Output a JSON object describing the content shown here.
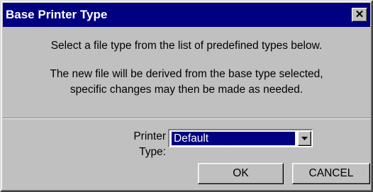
{
  "window": {
    "title": "Base Printer Type",
    "close_glyph": "✕"
  },
  "message": {
    "line1": "Select a file type from the list of predefined types below.",
    "line2a": "The new file will be derived from the base type selected,",
    "line2b": "specific changes may then be made as needed."
  },
  "printer_type": {
    "label": "Printer Type:",
    "value": "Default"
  },
  "buttons": {
    "ok": "OK",
    "cancel": "CANCEL"
  },
  "colors": {
    "titlebar": "#000080",
    "face": "#c0c0c0",
    "selection": "#000080"
  }
}
